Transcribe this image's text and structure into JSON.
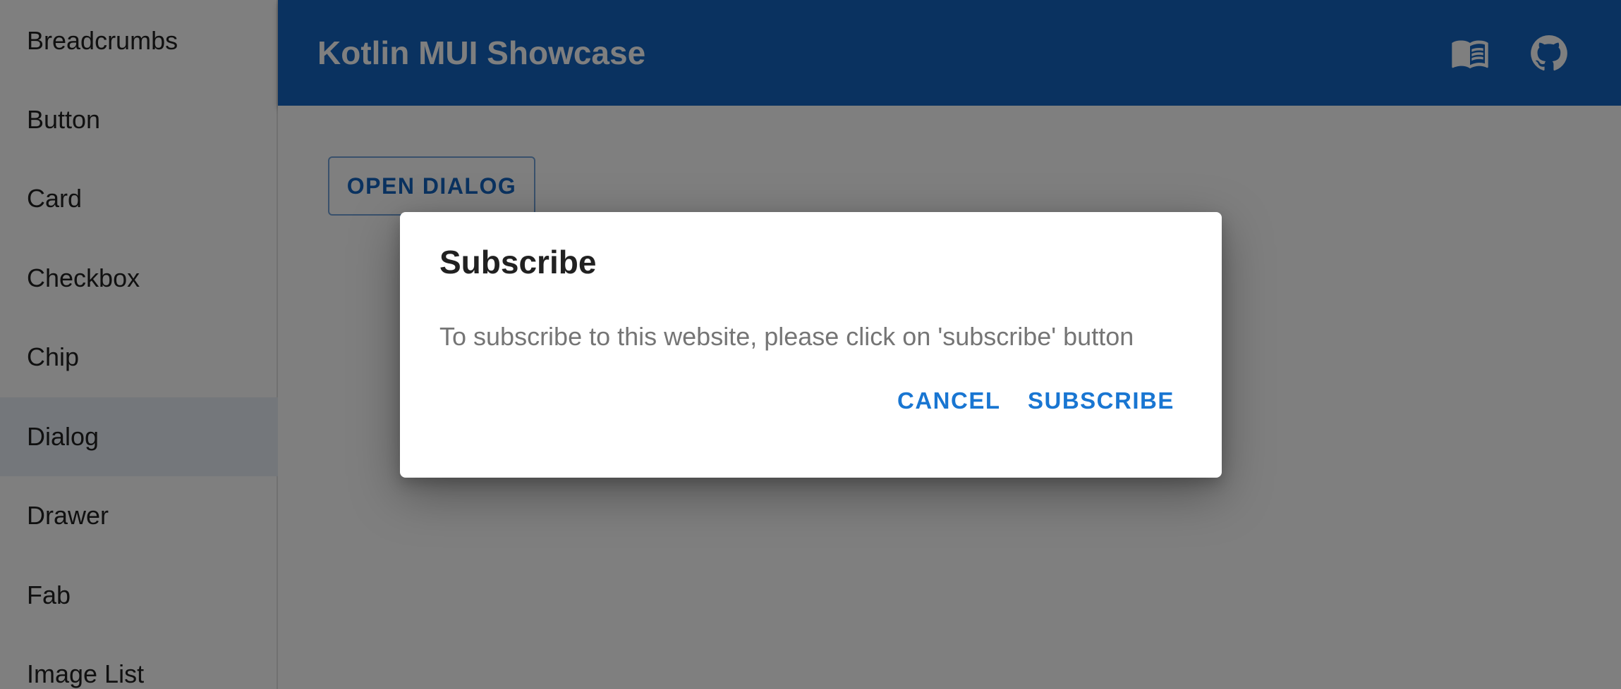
{
  "sidebar": {
    "items": [
      {
        "label": "Breadcrumbs"
      },
      {
        "label": "Button"
      },
      {
        "label": "Card"
      },
      {
        "label": "Checkbox"
      },
      {
        "label": "Chip"
      },
      {
        "label": "Dialog",
        "selected": true
      },
      {
        "label": "Drawer"
      },
      {
        "label": "Fab"
      },
      {
        "label": "Image List"
      }
    ]
  },
  "appbar": {
    "title": "Kotlin MUI Showcase",
    "icons": [
      "book-icon",
      "github-icon"
    ]
  },
  "content": {
    "open_dialog_label": "OPEN DIALOG"
  },
  "dialog": {
    "title": "Subscribe",
    "text": "To subscribe to this website, please click on 'subscribe' button",
    "cancel_label": "CANCEL",
    "subscribe_label": "SUBSCRIBE"
  },
  "colors": {
    "primary": "#1565c0",
    "action": "#1976d2",
    "selected_bg": "#e8eef6"
  }
}
